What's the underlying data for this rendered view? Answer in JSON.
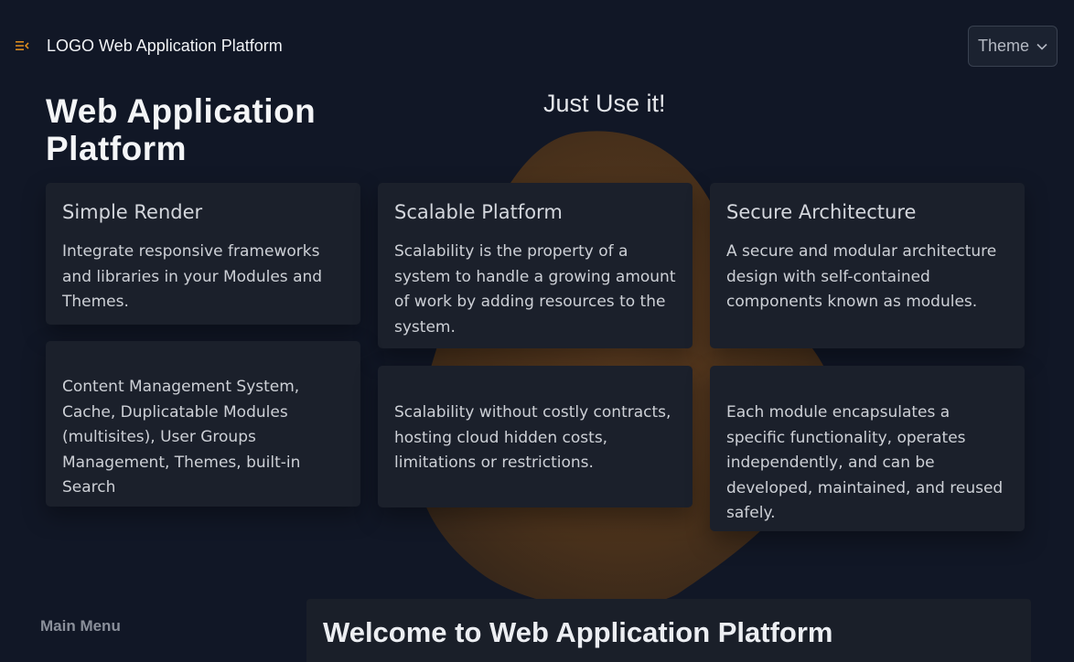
{
  "header": {
    "menu_icon": "menu-collapse-icon",
    "brand": "LOGO Web Application Platform",
    "theme_label": "Theme",
    "theme_icon": "chevron-down-icon"
  },
  "hero": {
    "title": "Web Application Platform",
    "tagline": "Just Use it!"
  },
  "cards": [
    {
      "title": "Simple Render",
      "text": "Integrate responsive frameworks and libraries in your Modules and Themes."
    },
    {
      "title": "Scalable Platform",
      "text": "Scalability is the property of a system to handle a growing amount of work by adding resources to the system."
    },
    {
      "title": "Secure Architecture",
      "text": "A secure and modular architecture design with self-contained components known as modules."
    },
    {
      "title": "",
      "text": "Content Management System, Cache, Duplicatable Modules (multisites), User Groups Management, Themes, built-in Search"
    },
    {
      "title": "",
      "text": "Scalability without costly contracts, hosting cloud hidden costs, limitations or restrictions."
    },
    {
      "title": "",
      "text": "Each module encapsulates a specific functionality, operates independently, and can be developed, maintained, and reused safely."
    }
  ],
  "sidebar": {
    "label": "Main Menu"
  },
  "main": {
    "welcome": "Welcome to Web Application Platform"
  },
  "colors": {
    "background": "#111726",
    "card": "#1b202b",
    "accent": "#d98a1e",
    "blob": "#5a3a1c"
  }
}
